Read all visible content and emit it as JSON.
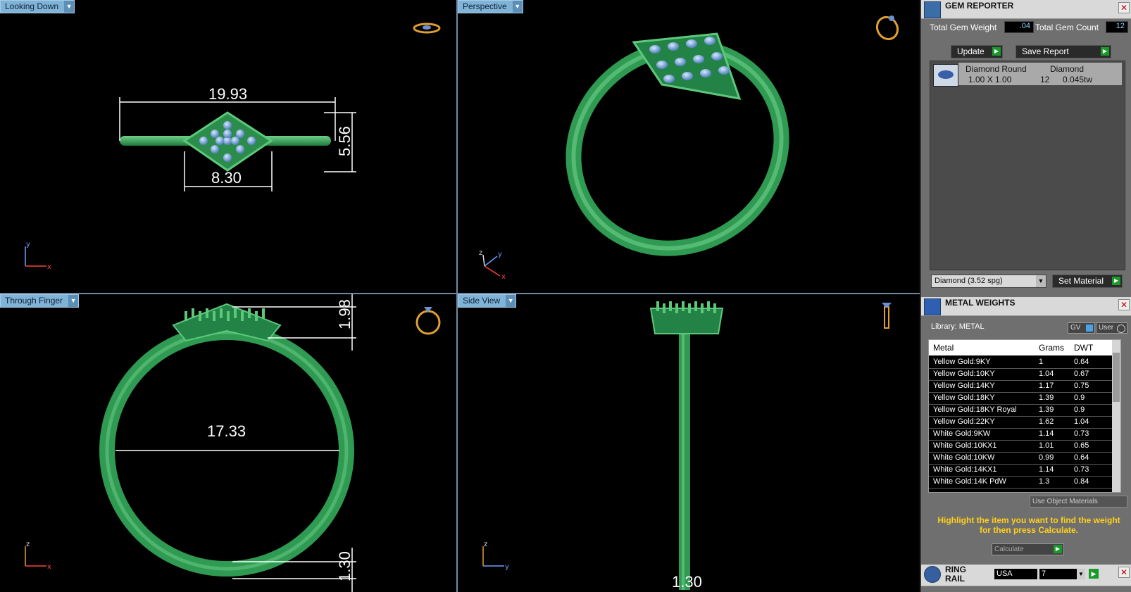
{
  "viewports": {
    "top_left": {
      "label": "Looking Down",
      "dims": {
        "width": "19.93",
        "height": "5.56",
        "head": "8.30"
      }
    },
    "top_right": {
      "label": "Perspective"
    },
    "bottom_left": {
      "label": "Through Finger",
      "dims": {
        "diameter": "17.33",
        "top_height": "1.98",
        "band": "1.30"
      }
    },
    "bottom_right": {
      "label": "Side View",
      "dims": {
        "band": "1.30"
      }
    }
  },
  "axes": {
    "x": "x",
    "y": "y",
    "z": "z"
  },
  "gem_reporter": {
    "title": "GEM REPORTER",
    "total_weight_label": "Total Gem Weight",
    "total_weight_value": ".04",
    "total_count_label": "Total Gem Count",
    "total_count_value": "12",
    "update_label": "Update",
    "save_report_label": "Save Report",
    "gem": {
      "name": "Diamond Round",
      "size": "1.00 X 1.00",
      "material": "Diamond",
      "count": "12",
      "weight": "0.045tw"
    },
    "material_select": "Diamond    (3.52 spg)",
    "set_material_label": "Set Material"
  },
  "metal_weights": {
    "title": "METAL WEIGHTS",
    "library_label": "Library: METAL",
    "gv_label": "GV",
    "user_label": "User",
    "columns": [
      "Metal",
      "Grams",
      "DWT"
    ],
    "rows": [
      {
        "metal": "Yellow Gold:9KY",
        "grams": "1",
        "dwt": "0.64"
      },
      {
        "metal": "Yellow Gold:10KY",
        "grams": "1.04",
        "dwt": "0.67"
      },
      {
        "metal": "Yellow Gold:14KY",
        "grams": "1.17",
        "dwt": "0.75"
      },
      {
        "metal": "Yellow Gold:18KY",
        "grams": "1.39",
        "dwt": "0.9"
      },
      {
        "metal": "Yellow Gold:18KY Royal",
        "grams": "1.39",
        "dwt": "0.9"
      },
      {
        "metal": "Yellow Gold:22KY",
        "grams": "1.62",
        "dwt": "1.04"
      },
      {
        "metal": "White Gold:9KW",
        "grams": "1.14",
        "dwt": "0.73"
      },
      {
        "metal": "White Gold:10KX1",
        "grams": "1.01",
        "dwt": "0.65"
      },
      {
        "metal": "White Gold:10KW",
        "grams": "0.99",
        "dwt": "0.64"
      },
      {
        "metal": "White Gold:14KX1",
        "grams": "1.14",
        "dwt": "0.73"
      },
      {
        "metal": "White Gold:14K PdW",
        "grams": "1.3",
        "dwt": "0.84"
      }
    ],
    "use_object_materials_label": "Use Object Materials",
    "instruction": "Highlight the item you want to find the weight for then press Calculate.",
    "calculate_label": "Calculate"
  },
  "ring_rail": {
    "title": "RING RAIL",
    "country": "USA",
    "size": "7"
  }
}
